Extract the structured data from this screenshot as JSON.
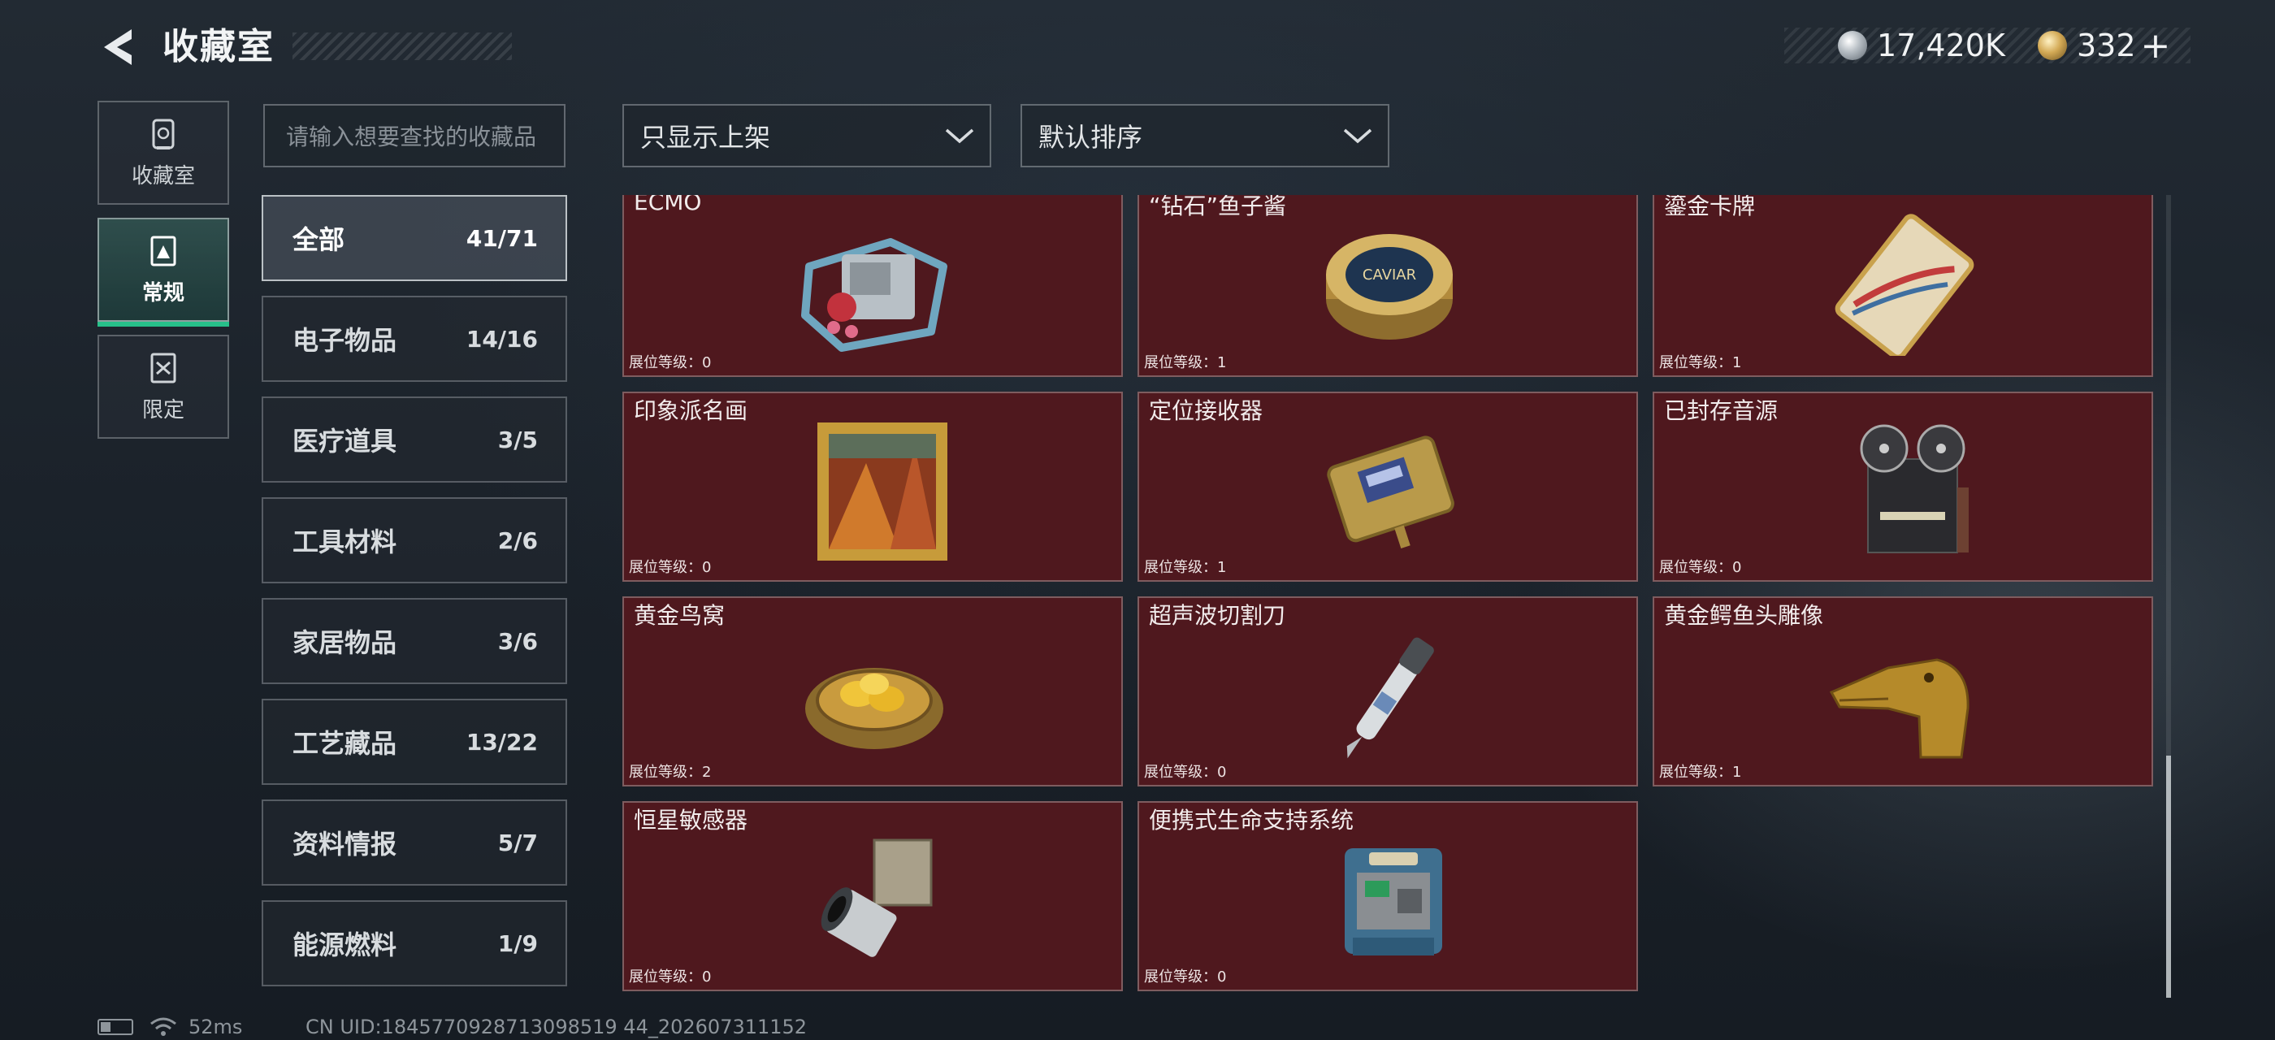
{
  "header": {
    "title": "收藏室",
    "currencies": [
      {
        "icon": "silver-coin-icon",
        "value": "17,420K"
      },
      {
        "icon": "gold-coin-icon",
        "value": "332"
      }
    ],
    "plus_label": "+"
  },
  "side_nav": [
    {
      "label": "收藏室",
      "icon": "collection-room-icon",
      "active": false
    },
    {
      "label": "常规",
      "icon": "regular-icon",
      "active": true
    },
    {
      "label": "限定",
      "icon": "limited-icon",
      "active": false
    }
  ],
  "search": {
    "placeholder": "请输入想要查找的收藏品"
  },
  "filters": {
    "shelf_filter": "只显示上架",
    "sort": "默认排序"
  },
  "categories": [
    {
      "name": "全部",
      "count": "41/71",
      "active": true
    },
    {
      "name": "电子物品",
      "count": "14/16",
      "active": false
    },
    {
      "name": "医疗道具",
      "count": "3/5",
      "active": false
    },
    {
      "name": "工具材料",
      "count": "2/6",
      "active": false
    },
    {
      "name": "家居物品",
      "count": "3/6",
      "active": false
    },
    {
      "name": "工艺藏品",
      "count": "13/22",
      "active": false
    },
    {
      "name": "资料情报",
      "count": "5/7",
      "active": false
    },
    {
      "name": "能源燃料",
      "count": "1/9",
      "active": false
    }
  ],
  "items": [
    {
      "name": "ECMO",
      "level": "展位等级：0",
      "icon": "ecmo-machine-icon"
    },
    {
      "name": "“钻石”鱼子酱",
      "level": "展位等级：1",
      "icon": "caviar-tin-icon",
      "tin_label": "CAVIAR"
    },
    {
      "name": "鎏金卡牌",
      "level": "展位等级：1",
      "icon": "gilded-card-icon"
    },
    {
      "name": "印象派名画",
      "level": "展位等级：0",
      "icon": "framed-painting-icon"
    },
    {
      "name": "定位接收器",
      "level": "展位等级：1",
      "icon": "gps-receiver-icon"
    },
    {
      "name": "已封存音源",
      "level": "展位等级：0",
      "icon": "reel-tape-recorder-icon"
    },
    {
      "name": "黄金鸟窝",
      "level": "展位等级：2",
      "icon": "golden-nest-icon"
    },
    {
      "name": "超声波切割刀",
      "level": "展位等级：0",
      "icon": "ultrasonic-cutter-icon"
    },
    {
      "name": "黄金鳄鱼头雕像",
      "level": "展位等级：1",
      "icon": "gold-crocodile-head-icon"
    },
    {
      "name": "恒星敏感器",
      "level": "展位等级：0",
      "icon": "star-sensor-icon"
    },
    {
      "name": "便携式生命支持系统",
      "level": "展位等级：0",
      "icon": "life-support-system-icon"
    }
  ],
  "status": {
    "ping": "52ms",
    "uid": "CN UID:1845770928713098519 44_202607311152"
  },
  "colors": {
    "card_bg": "#4f181e",
    "active_green": "#27c08a"
  }
}
